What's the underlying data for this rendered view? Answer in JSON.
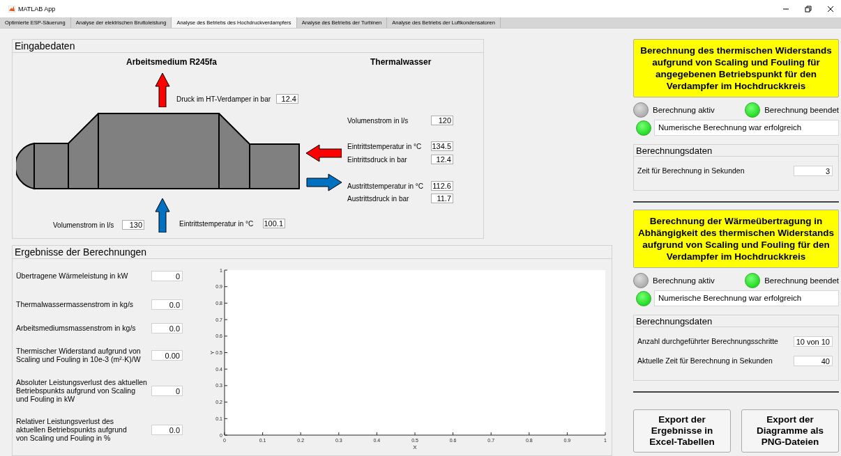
{
  "window": {
    "title": "MATLAB App"
  },
  "tabs": [
    {
      "label": "Optimierte ESP-Säuerung",
      "selected": false
    },
    {
      "label": "Analyse der elektrischen Bruttoleistung",
      "selected": false
    },
    {
      "label": "Analyse des Betriebs des Hochdruckverdampfers",
      "selected": true
    },
    {
      "label": "Analyse des Betriebs der Turbinen",
      "selected": false
    },
    {
      "label": "Analyse des Betriebs der Luftkondensatoren",
      "selected": false
    }
  ],
  "input_panel": {
    "title": "Eingabedaten",
    "working_medium_heading": "Arbeitsmedium R245fa",
    "thermal_water_heading": "Thermalwasser",
    "fields": [
      {
        "label": "Druck im HT-Verdamper in bar",
        "value": "12.4"
      },
      {
        "label": "Volumenstrom in l/s",
        "value": "120"
      },
      {
        "label": "Eintrittstemperatur in °C",
        "value": "134.5"
      },
      {
        "label": "Eintrittsdruck in bar",
        "value": "12.4"
      },
      {
        "label": "Austrittstemperatur in °C",
        "value": "112.6"
      },
      {
        "label": "Austrittsdruck in bar",
        "value": "11.7"
      },
      {
        "label": "Volumenstrom in l/s",
        "value": "130"
      },
      {
        "label": "Eintrittstemperatur in °C",
        "value": "100.1"
      }
    ]
  },
  "results_panel": {
    "title": "Ergebnisse der Berechnungen",
    "fields": [
      {
        "label": "Übertragene Wärmeleistung  in kW",
        "value": "0"
      },
      {
        "label": "Thermalwassermassenstrom in kg/s",
        "value": "0.0"
      },
      {
        "label": "Arbeitsmediumsmassenstrom in kg/s",
        "value": "0.0"
      },
      {
        "label": "Thermischer Widerstand aufgrund von\nScaling und Fouling in 10e-3 (m²·K)/W",
        "value": "0.00"
      },
      {
        "label": "Absoluter Leistungsverlust des aktuellen\nBetriebspunkts aufgrund von Scaling\nund Fouling in kW",
        "value": "0"
      },
      {
        "label": "Relativer Leistungsverlust des\naktuellen Betriebspunkts aufgrund\nvon Scaling und Fouling in %",
        "value": "0.0"
      }
    ],
    "chart_data": {
      "type": "line",
      "xlabel": "X",
      "ylabel": "Y",
      "xlim": [
        0,
        1
      ],
      "ylim": [
        0,
        1
      ],
      "xticks": [
        0,
        0.1,
        0.2,
        0.3,
        0.4,
        0.5,
        0.6,
        0.7,
        0.8,
        0.9,
        1
      ],
      "yticks": [
        0,
        0.1,
        0.2,
        0.3,
        0.4,
        0.5,
        0.6,
        0.7,
        0.8,
        0.9,
        1
      ]
    }
  },
  "sections": [
    {
      "heading": "Berechnung des thermischen Widerstands aufgrund von Scaling und Fouling für angegebenen Betriebspunkt für den Verdampfer im Hochdruckkreis",
      "lamps": [
        {
          "label": "Berechnung aktiv",
          "on": false
        },
        {
          "label": "Berechnung beendet",
          "on": true
        }
      ],
      "status": {
        "on": true,
        "text": "Numerische Berechnung war erfolgreich"
      },
      "data_panel": {
        "title": "Berechnungsdaten",
        "fields": [
          {
            "label": "Zeit für Berechnung in Sekunden",
            "value": "3"
          }
        ]
      }
    },
    {
      "heading": "Berechnung der Wärmeübertragung in Abhängigkeit des thermischen Widerstands aufgrund von Scaling und Fouling für den Verdampfer im Hochdruckkreis",
      "lamps": [
        {
          "label": "Berechnung aktiv",
          "on": false
        },
        {
          "label": "Berechnung beendet",
          "on": true
        }
      ],
      "status": {
        "on": true,
        "text": "Numerische Berechnung war erfolgreich"
      },
      "data_panel": {
        "title": "Berechnungsdaten",
        "fields": [
          {
            "label": "Anzahl durchgeführter Berechnungsschritte",
            "value": "10 von 10"
          },
          {
            "label": "Aktuelle Zeit für Berechnung in Sekunden",
            "value": "40"
          }
        ]
      }
    }
  ],
  "buttons": [
    "Export der\nErgebnisse in\nExcel-Tabellen",
    "Export der\nDiagramme als\nPNG-Dateien"
  ]
}
